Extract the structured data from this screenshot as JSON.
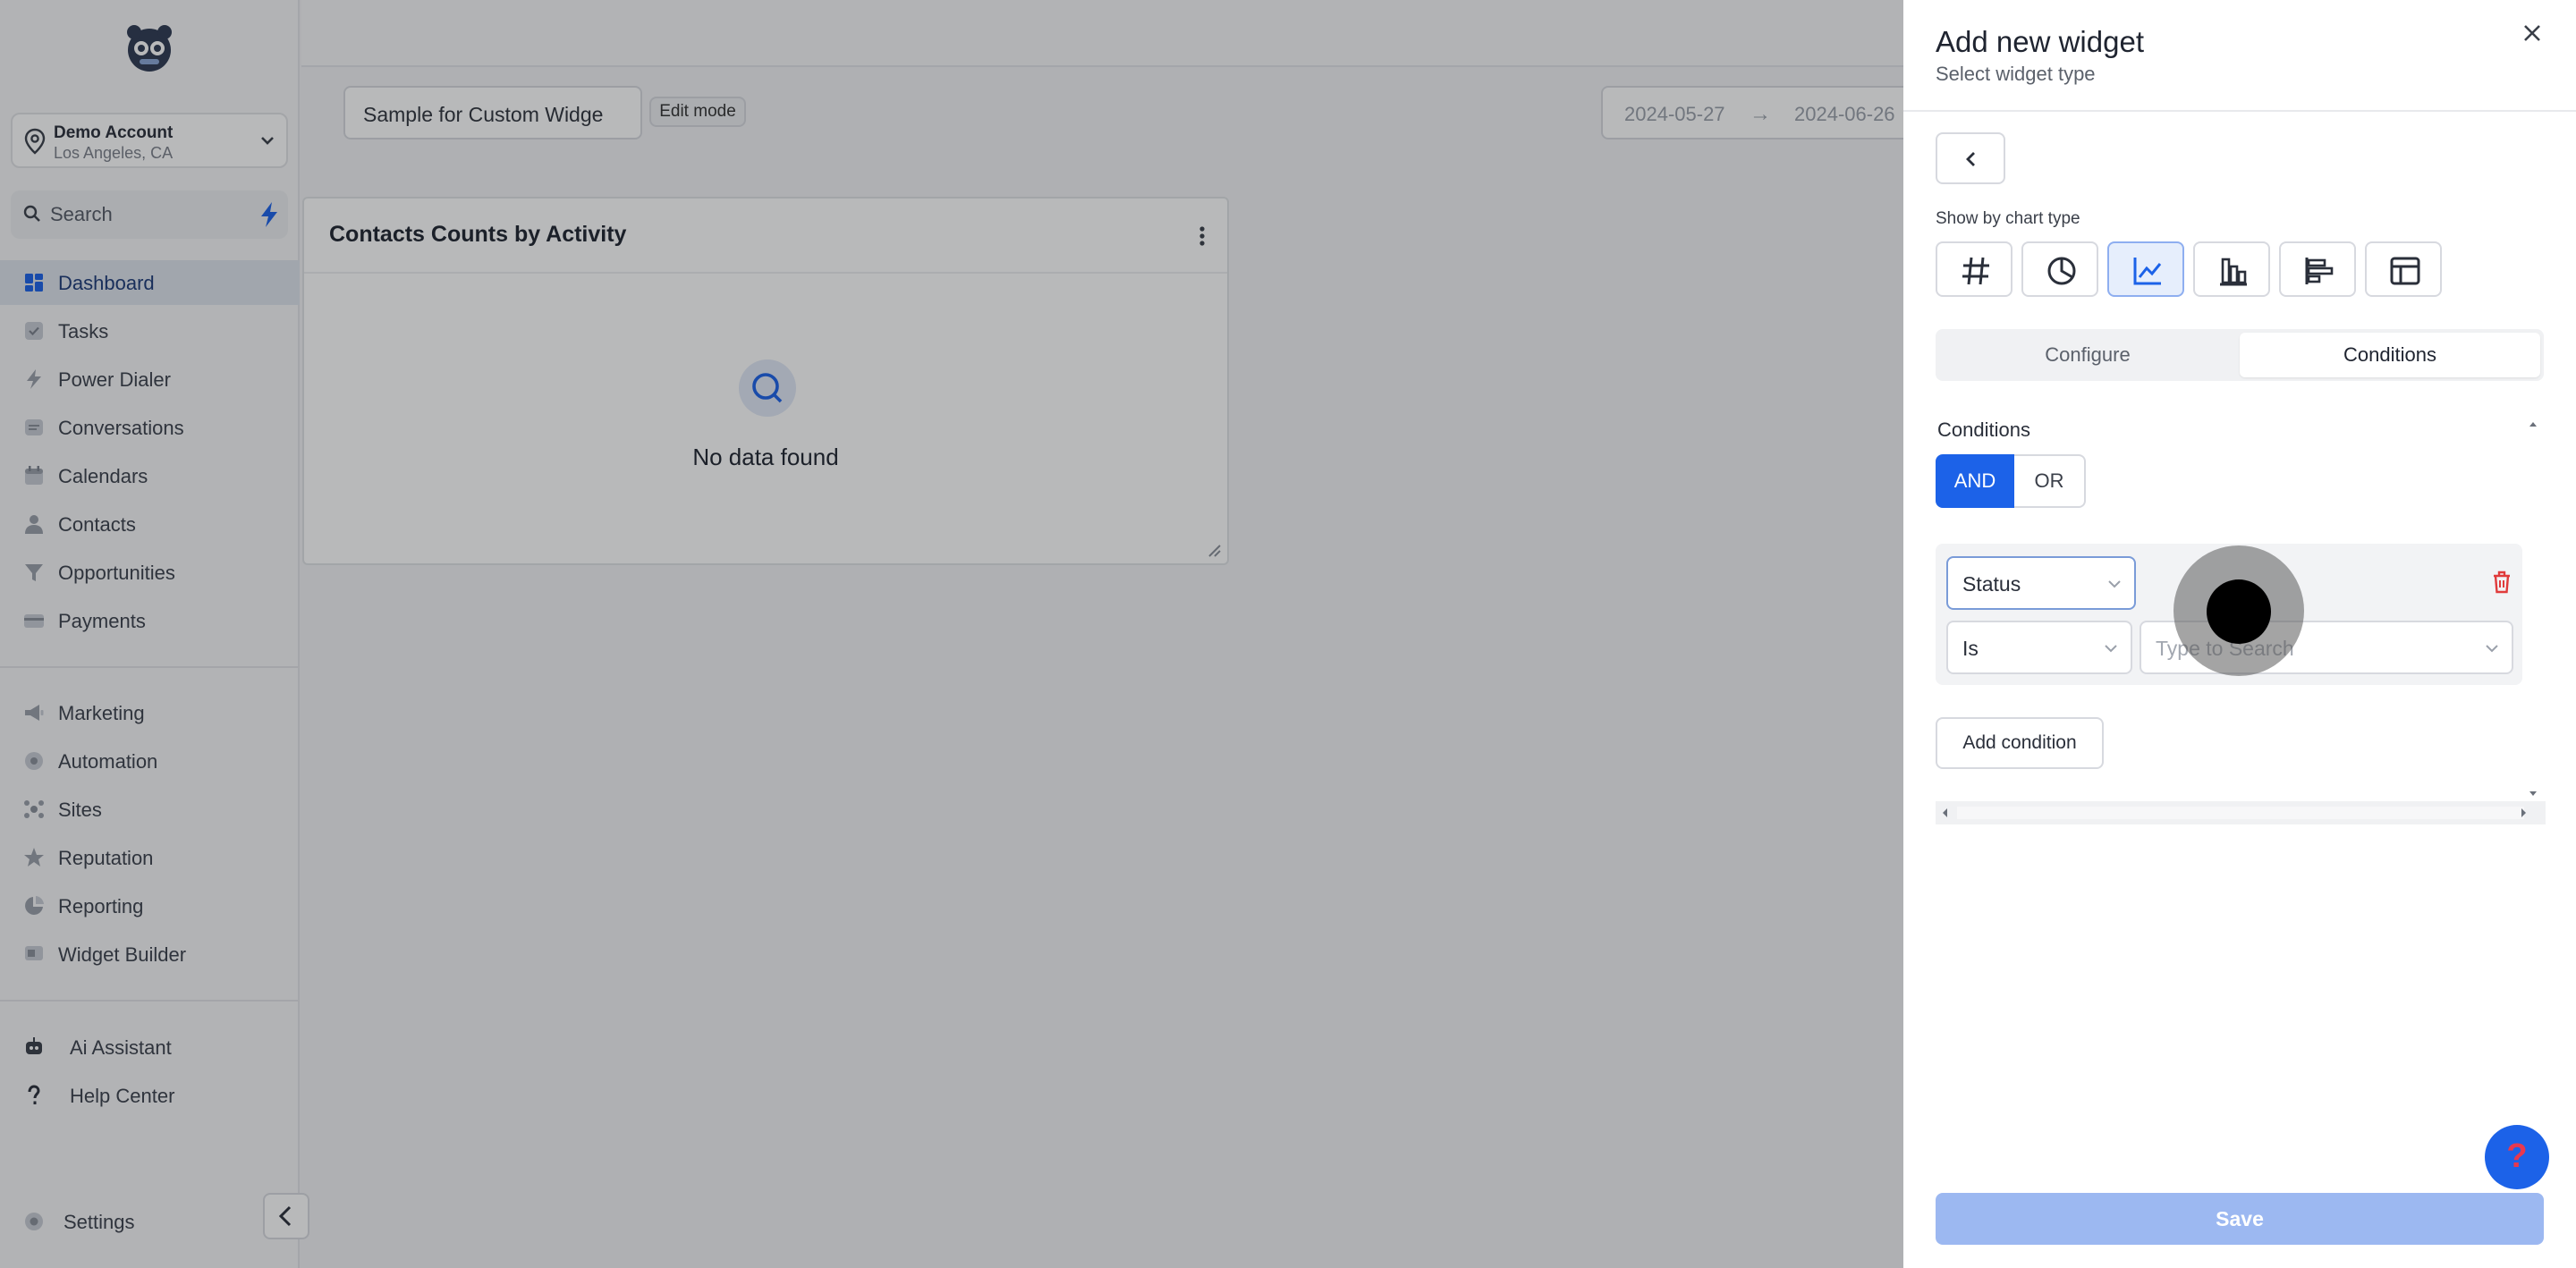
{
  "sidebar": {
    "account": {
      "name": "Demo Account",
      "location": "Los Angeles, CA"
    },
    "search": {
      "label": "Search"
    },
    "items": [
      {
        "label": "Dashboard",
        "icon": "dashboard-icon",
        "active": true
      },
      {
        "label": "Tasks",
        "icon": "tasks-icon"
      },
      {
        "label": "Power Dialer",
        "icon": "bolt-icon"
      },
      {
        "label": "Conversations",
        "icon": "conversations-icon"
      },
      {
        "label": "Calendars",
        "icon": "calendar-icon"
      },
      {
        "label": "Contacts",
        "icon": "contacts-icon"
      },
      {
        "label": "Opportunities",
        "icon": "filter-icon"
      },
      {
        "label": "Payments",
        "icon": "payments-icon"
      },
      {
        "label": "Marketing",
        "icon": "megaphone-icon"
      },
      {
        "label": "Automation",
        "icon": "automation-icon"
      },
      {
        "label": "Sites",
        "icon": "sites-icon"
      },
      {
        "label": "Reputation",
        "icon": "reputation-icon"
      },
      {
        "label": "Reporting",
        "icon": "reporting-icon"
      },
      {
        "label": "Widget Builder",
        "icon": "widget-icon"
      }
    ],
    "bottom_items": [
      {
        "label": "Ai Assistant",
        "icon": "robot-icon"
      },
      {
        "label": "Help Center",
        "icon": "question-icon"
      }
    ],
    "settings_label": "Settings"
  },
  "main": {
    "dashboard_name": "Sample for Custom Widge",
    "edit_mode_label": "Edit mode",
    "date_from": "2024-05-27",
    "date_arrow": "→",
    "date_to": "2024-06-26",
    "widget": {
      "title": "Contacts Counts by Activity",
      "empty_text": "No data found"
    }
  },
  "panel": {
    "title": "Add new widget",
    "subtitle": "Select widget type",
    "chart_type_label": "Show by chart type",
    "chart_types": [
      {
        "icon": "hash-icon",
        "active": false
      },
      {
        "icon": "pie-chart-icon",
        "active": false
      },
      {
        "icon": "line-chart-icon",
        "active": true
      },
      {
        "icon": "bar-chart-icon",
        "active": false
      },
      {
        "icon": "horizontal-bar-icon",
        "active": false
      },
      {
        "icon": "table-icon",
        "active": false
      }
    ],
    "tabs": [
      {
        "label": "Configure",
        "active": false
      },
      {
        "label": "Conditions",
        "active": true
      }
    ],
    "conditions": {
      "title": "Conditions",
      "and_label": "AND",
      "or_label": "OR",
      "field_value": "Status",
      "operator_value": "Is",
      "value_placeholder": "Type to Search",
      "add_label": "Add condition"
    },
    "save_label": "Save"
  },
  "colors": {
    "accent": "#1c62e8",
    "active_nav_bg": "#dfe4ed",
    "delete": "#e03b3b",
    "save_disabled": "#9cb8f1"
  }
}
